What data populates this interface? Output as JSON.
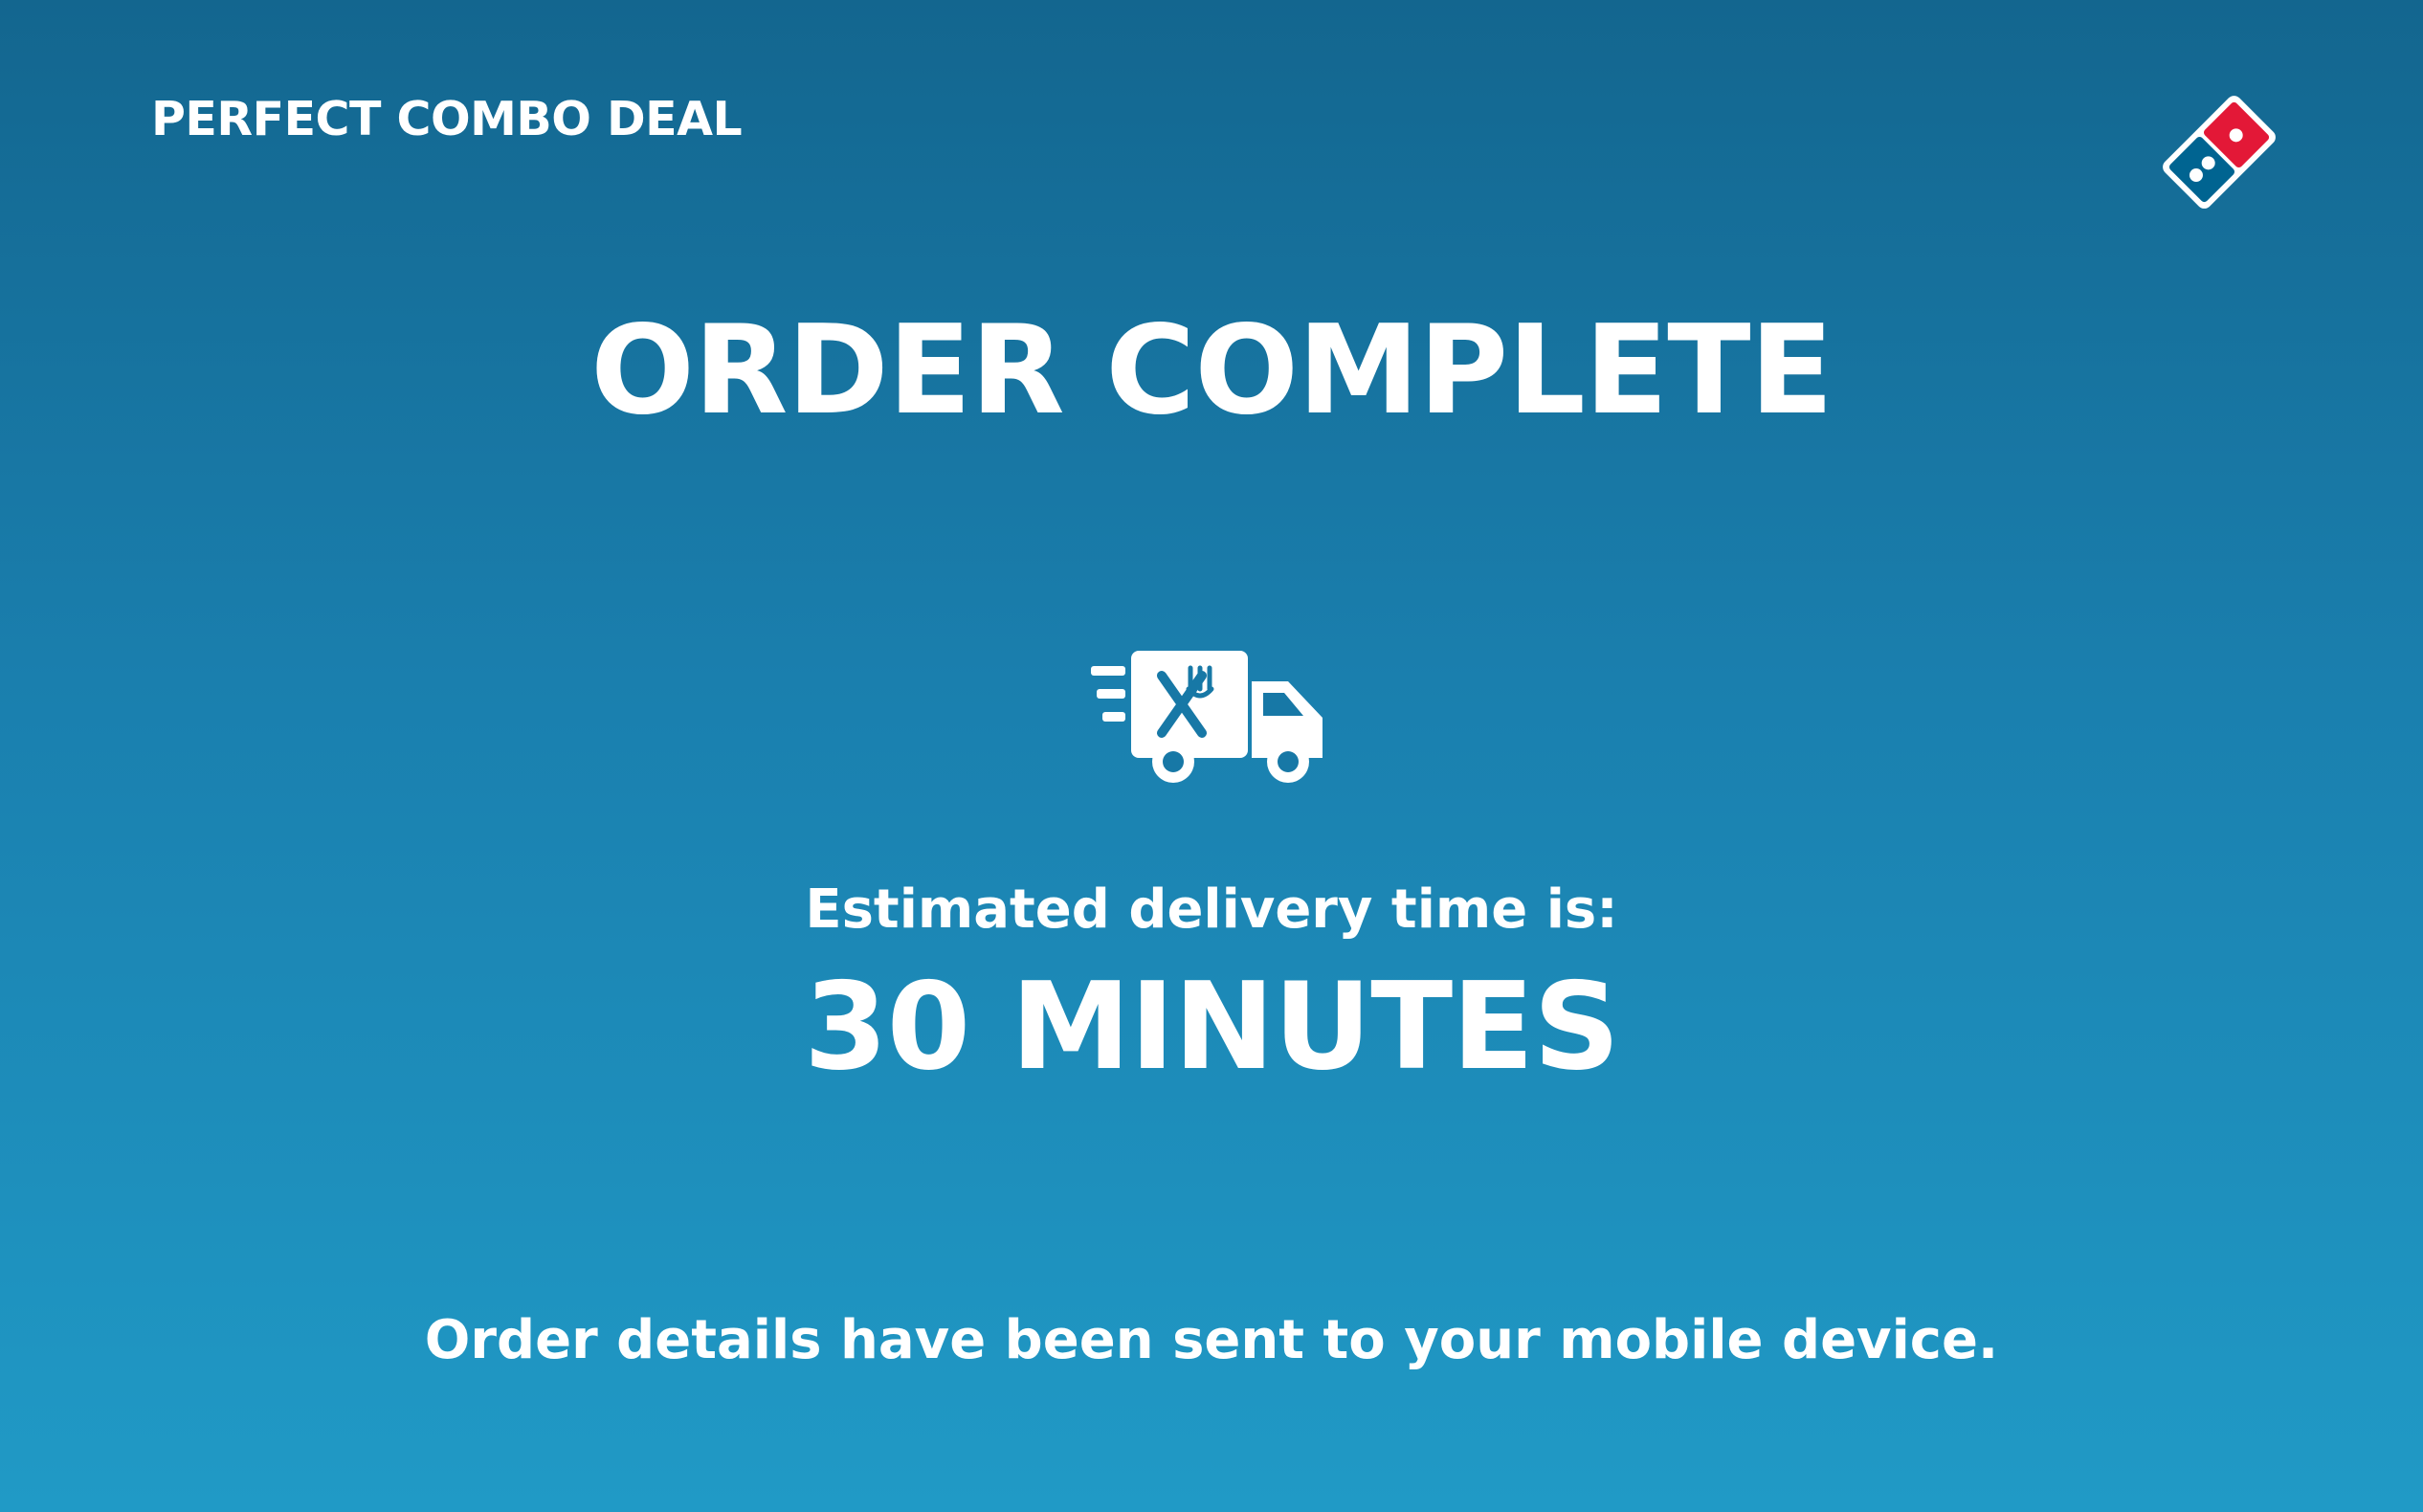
{
  "header": {
    "deal_title": "PERFECT COMBO DEAL",
    "logo_icon": "domino-tile-logo-icon"
  },
  "main": {
    "title": "ORDER COMPLETE",
    "status_icon": "delivery-truck-icon",
    "delivery_label": "Estimated delivery time is:",
    "delivery_time": "30 MINUTES",
    "footer_note": "Order details have been sent to your mobile device."
  },
  "colors": {
    "background_top": "#13668f",
    "background_bottom": "#209ac6",
    "text": "#ffffff",
    "logo_red": "#e31837",
    "logo_blue": "#006491"
  }
}
